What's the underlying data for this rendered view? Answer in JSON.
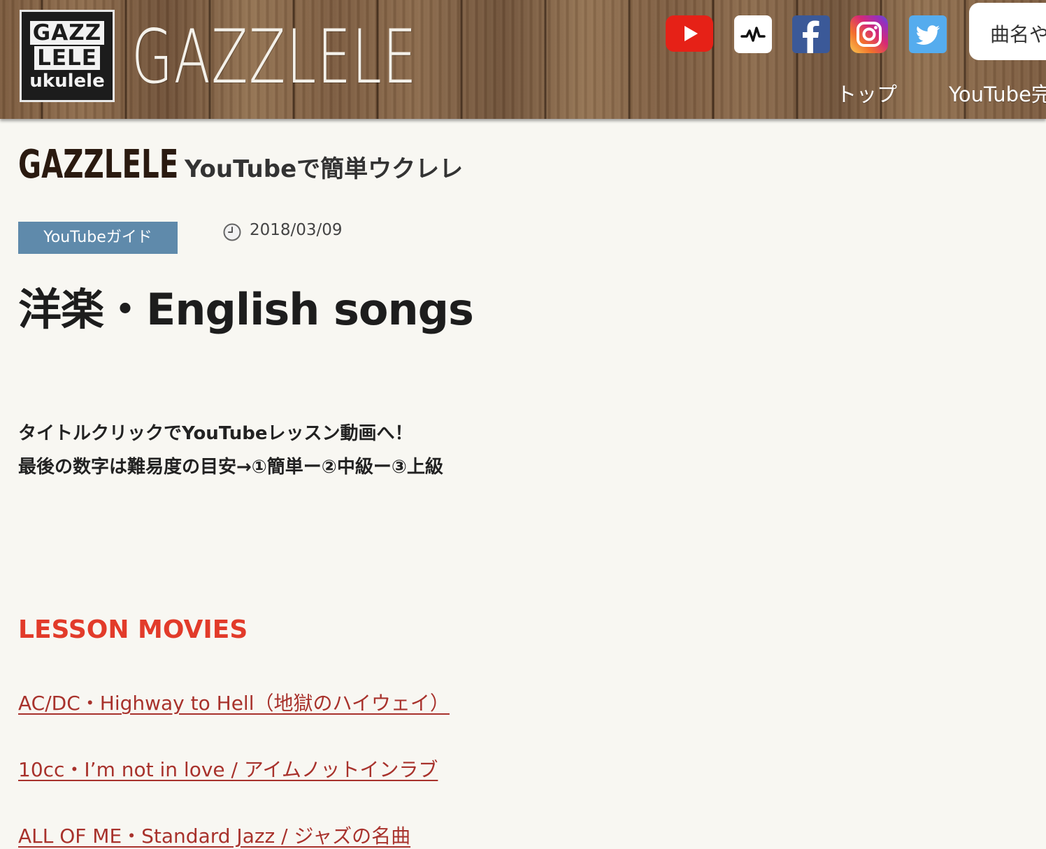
{
  "header": {
    "logo_box": {
      "line1": "GAZZ",
      "line2": "LELE",
      "line3": "ukulele"
    },
    "logo_word": "GAZZLELE",
    "social_icons": [
      "youtube-icon",
      "wave-icon",
      "facebook-icon",
      "instagram-icon",
      "twitter-icon"
    ],
    "search_placeholder": "曲名や",
    "nav": {
      "top": "トップ",
      "youtube": "YouTube完"
    }
  },
  "site": {
    "brand": "GAZZLELE",
    "tagline": "YouTubeで簡単ウクレレ"
  },
  "post": {
    "category": "YouTubeガイド",
    "date": "2018/03/09",
    "title": "洋楽・English songs",
    "intro_line1": "タイトルクリックでYouTubeレッスン動画へ！",
    "intro_line2": "最後の数字は難易度の目安→①簡単ー②中級ー③上級",
    "section_heading": "LESSON MOVIES",
    "links": [
      "AC/DC・Highway to Hell（地獄のハイウェイ）",
      "10cc・I’m not in love / アイムノットインラブ",
      "ALL OF ME・Standard Jazz / ジャズの名曲"
    ]
  },
  "colors": {
    "badge": "#5f8aab",
    "section_heading": "#e23b2a",
    "link": "#a8322c",
    "page_bg": "#f8f7f2"
  }
}
